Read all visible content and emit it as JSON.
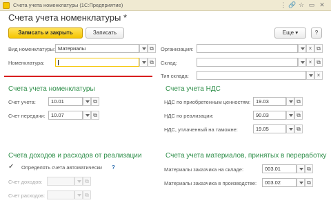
{
  "window": {
    "title": "Счета учета номенклатуры  (1С:Предприятие)",
    "buttons": [
      "⋮",
      "🔗",
      "☆",
      "▭",
      "✕"
    ]
  },
  "form": {
    "title": "Счета учета номенклатуры *"
  },
  "toolbar": {
    "save_close": "Записать и закрыть",
    "save": "Записать",
    "more": "Еще ▾",
    "help": "?"
  },
  "top": {
    "kind_label": "Вид номенклатуры:",
    "kind_value": "Материалы",
    "item_label": "Номенклатура:",
    "item_value": "",
    "org_label": "Организация:",
    "warehouse_label": "Склад:",
    "warehouse_type_label": "Тип склада:"
  },
  "sections": {
    "nomenclature": "Счета учета номенклатуры",
    "vat": "Счета учета НДС",
    "income": "Счета доходов и расходов от реализации",
    "materials": "Счета учета материалов, принятых в переработку"
  },
  "nomenclature": {
    "account_label": "Счет учета:",
    "account_value": "10.01",
    "transfer_label": "Счет передачи:",
    "transfer_value": "10.07"
  },
  "vat": {
    "acquired_label": "НДС по приобретенным ценностям:",
    "acquired_value": "19.03",
    "sales_label": "НДС по реализации:",
    "sales_value": "90.03",
    "customs_label": "НДС, уплаченный на таможне:",
    "customs_value": "19.05"
  },
  "income": {
    "auto_label": "Определять счета автоматически",
    "auto_checked": "✓",
    "help": "?",
    "income_label": "Счет доходов:",
    "expense_label": "Счет расходов:"
  },
  "materials": {
    "warehouse_label": "Материалы заказчика на складе:",
    "warehouse_value": "003.01",
    "production_label": "Материалы заказчика в производстве:",
    "production_value": "003.02"
  },
  "colors": {
    "accent": "#f5c500",
    "section": "#2f8f4a",
    "highlight": "#d81e1e"
  }
}
